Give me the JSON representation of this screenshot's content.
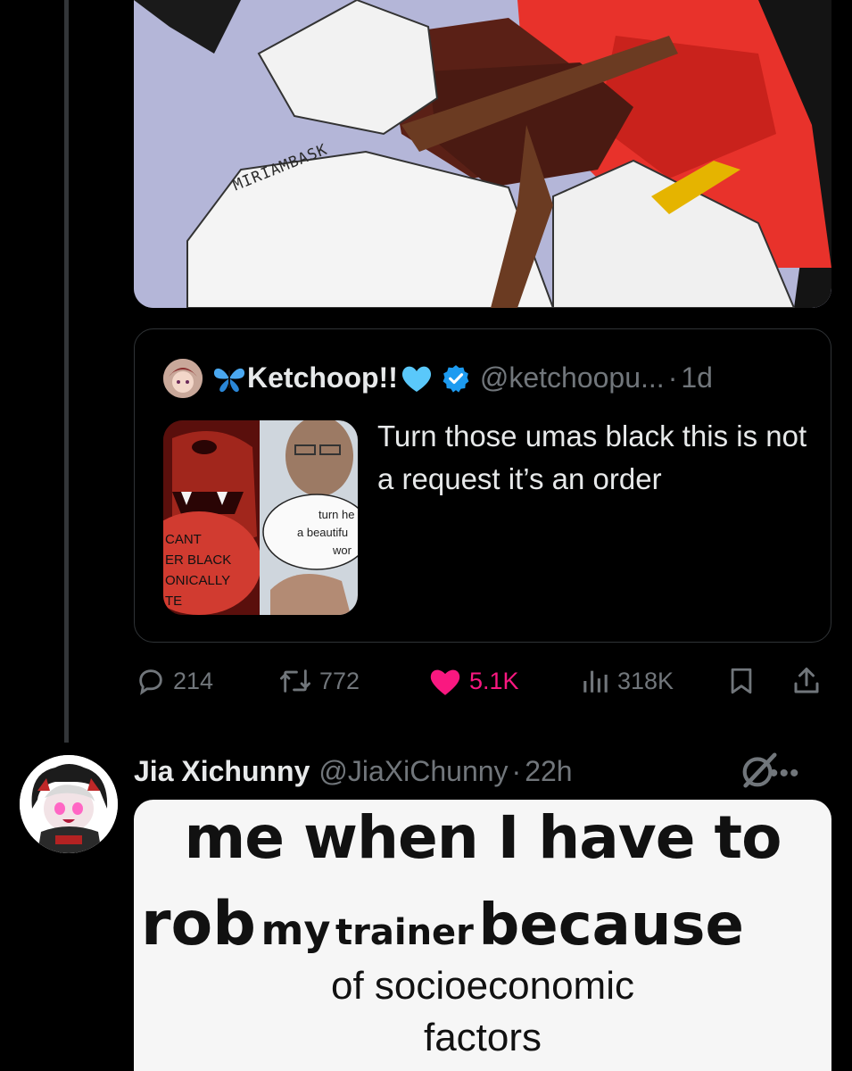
{
  "artwork": {
    "signature": "MIRIAMBASK"
  },
  "quoted_tweet": {
    "display_name": "Ketchoop!!",
    "handle": "@ketchoopu...",
    "separator": "·",
    "time": "1d",
    "text": "Turn those umas black this is not a request it’s an order",
    "thumb_left_lines": [
      "CANT",
      "ER BLACK",
      "ONICALLY",
      "TE"
    ],
    "thumb_bubble_lines": [
      "turn he",
      "a beautifu",
      "wor"
    ]
  },
  "actions": {
    "replies": "214",
    "reposts": "772",
    "likes": "5.1K",
    "views": "318K"
  },
  "tweet": {
    "display_name": "Jia Xichunny",
    "handle": "@JiaXiChunny",
    "separator": "·",
    "time": "22h",
    "meme": {
      "line1": "me when I have to",
      "w_rob": "rob",
      "w_my": "my",
      "w_trainer": "trainer",
      "w_because": "because",
      "line3": "of socioeconomic",
      "line4": "factors"
    }
  },
  "colors": {
    "background": "#000000",
    "border": "#2f3336",
    "muted": "#71767b",
    "like_pink": "#f91880",
    "verified_blue": "#1d9bf0"
  }
}
